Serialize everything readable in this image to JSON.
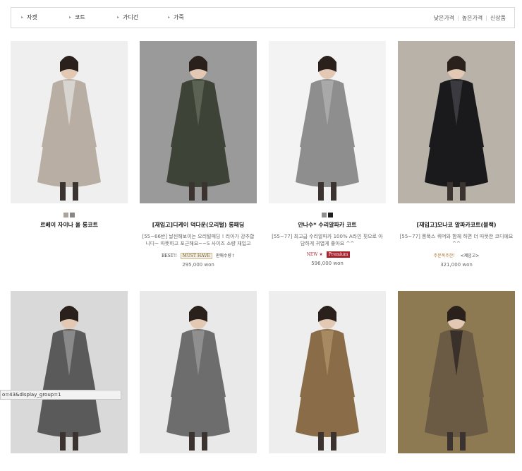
{
  "nav": {
    "categories": [
      {
        "label": "자켓"
      },
      {
        "label": "코트"
      },
      {
        "label": "가디건"
      },
      {
        "label": "가죽"
      }
    ],
    "sorts": [
      {
        "label": "낮은가격"
      },
      {
        "label": "높은가격"
      },
      {
        "label": "신상품"
      }
    ]
  },
  "products": [
    {
      "title": "르베이 자이나 울 롱코트",
      "desc": "",
      "swatches": [
        "#a9a39c",
        "#8a8580"
      ],
      "badges": [],
      "price": "",
      "photo": {
        "bg": "#efefef",
        "coat": "#b9aea4",
        "accent": "#d8d4cf"
      }
    },
    {
      "title": "[재입고]디케이 덕다운(오리털) 롱패딩",
      "desc": "[55~66반] 날씬해보이는 오리털패딩 ! 리아가 강추합니다~ 따뜻하고 포근해요~~S 사이즈 소량 재입고",
      "swatches": [],
      "badges": [
        {
          "text": "BEST!!",
          "color": "#333333",
          "bg": "#ffffff",
          "border": "#ffffff"
        },
        {
          "text": "MUST HAVE",
          "color": "#6b5a33",
          "bg": "#f4efe2",
          "border": "#c9bb93"
        },
        {
          "text": "판매수량↑",
          "color": "#444444",
          "bg": "#ffffff",
          "border": "#ffffff"
        }
      ],
      "price": "295,000 won",
      "photo": {
        "bg": "#9a9a9a",
        "coat": "#3d4437",
        "accent": "#5b6354"
      }
    },
    {
      "title": "안나수* 수리알파카 코트",
      "desc": "[55~77] 최고급 수리알파카 100% A라인 핏으로 아담하게 귀엽게 좋아요 ^^",
      "swatches": [
        "#8f8f8f",
        "#1f1f1f"
      ],
      "badges": [
        {
          "text": "NEW ★",
          "color": "#b0303d",
          "bg": "#ffffff",
          "border": "#ffffff"
        },
        {
          "text": "Premium",
          "color": "#ffffff",
          "bg": "#a8232e",
          "border": "#a8232e"
        }
      ],
      "price": "596,000 won",
      "photo": {
        "bg": "#f3f3f3",
        "coat": "#8e8e8e",
        "accent": "#a9a9a9"
      }
    },
    {
      "title": "[재입고]모나코 알파카코트(블랙)",
      "desc": "[55~77] 롱폭스 퀴머와 함께 하면 더 따뜻한 코디에요^^",
      "swatches": [],
      "badges": [
        {
          "text": "주문폭주한!",
          "color": "#b07a2c",
          "bg": "#ffffff",
          "border": "#ffffff"
        },
        {
          "text": "<제입고>",
          "color": "#444444",
          "bg": "#ffffff",
          "border": "#ffffff"
        }
      ],
      "price": "321,000 won",
      "photo": {
        "bg": "#b8b2a8",
        "coat": "#1a1a1d",
        "accent": "#3a3a40"
      }
    },
    {
      "title": "",
      "desc": "",
      "swatches": [],
      "badges": [],
      "price": "",
      "photo": {
        "bg": "#d9d9d9",
        "coat": "#5a5a5a",
        "accent": "#8a8a8a"
      }
    },
    {
      "title": "",
      "desc": "",
      "swatches": [],
      "badges": [],
      "price": "",
      "photo": {
        "bg": "#e9e9e9",
        "coat": "#6d6d6d",
        "accent": "#8f8f8f"
      }
    },
    {
      "title": "",
      "desc": "",
      "swatches": [],
      "badges": [],
      "price": "",
      "photo": {
        "bg": "#eeeeee",
        "coat": "#8a6d48",
        "accent": "#a88a62"
      }
    },
    {
      "title": "",
      "desc": "",
      "swatches": [],
      "badges": [],
      "price": "",
      "photo": {
        "bg": "#8e7a52",
        "coat": "#6b5a44",
        "accent": "#3a302a"
      }
    }
  ],
  "statusbar": {
    "text": "o=43&display_group=1"
  }
}
